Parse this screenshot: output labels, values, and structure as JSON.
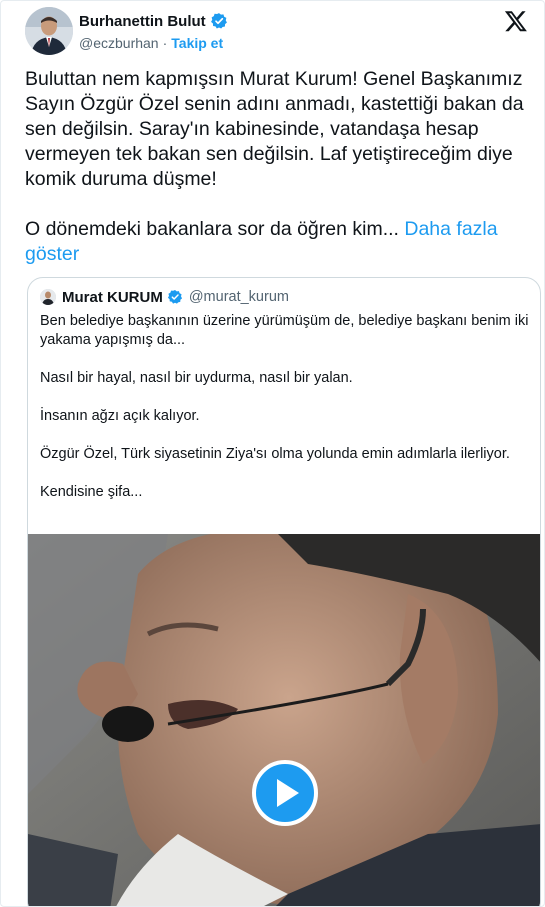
{
  "author": {
    "name": "Burhanettin Bulut",
    "handle": "@eczburhan",
    "separator": "·",
    "follow_label": "Takip et"
  },
  "tweet": {
    "paragraph_1": "Buluttan nem kapmışsın Murat Kurum! Genel Başkanımız Sayın Özgür Özel senin adını anmadı, kastettiği bakan da sen değilsin. Saray'ın kabinesinde, vatandaşa hesap vermeyen tek bakan sen değilsin. Laf yetiştireceğim diye komik duruma düşme!",
    "paragraph_2": "O dönemdeki bakanlara sor da öğren kim... ",
    "show_more_label": "Daha fazla göster"
  },
  "quoted": {
    "name": "Murat KURUM",
    "handle": "@murat_kurum",
    "lines": [
      "Ben belediye başkanının üzerine yürümüşüm de, belediye başkanı benim iki yakama yapışmış da...",
      "Nasıl bir hayal, nasıl bir uydurma, nasıl bir yalan.",
      "İnsanın ağzı açık kalıyor.",
      "Özgür Özel, Türk siyasetinin Ziya'sı olma yolunda emin adımlarla ilerliyor.",
      "Kendisine şifa..."
    ]
  },
  "icons": {
    "verified": "verified-badge-icon",
    "brand": "x-logo-icon",
    "play": "play-icon"
  },
  "colors": {
    "accent": "#1d9bf0",
    "text": "#0f1419",
    "secondary": "#536471",
    "border": "#cfd9de"
  }
}
